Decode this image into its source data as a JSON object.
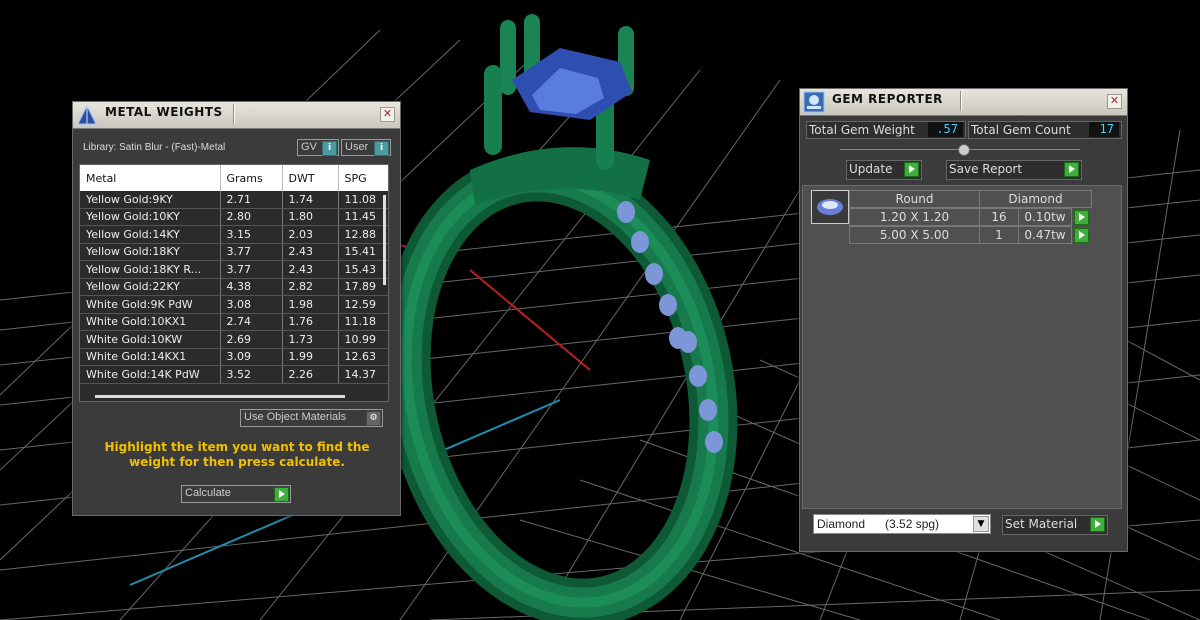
{
  "metal_weights": {
    "title": "METAL WEIGHTS",
    "library": "Library: Satin Blur - (Fast)-Metal",
    "gv_label": "GV",
    "user_label": "User",
    "columns": [
      "Metal",
      "Grams",
      "DWT",
      "SPG"
    ],
    "rows": [
      [
        "Yellow Gold:9KY",
        "2.71",
        "1.74",
        "11.08"
      ],
      [
        "Yellow Gold:10KY",
        "2.80",
        "1.80",
        "11.45"
      ],
      [
        "Yellow Gold:14KY",
        "3.15",
        "2.03",
        "12.88"
      ],
      [
        "Yellow Gold:18KY",
        "3.77",
        "2.43",
        "15.41"
      ],
      [
        "Yellow Gold:18KY R...",
        "3.77",
        "2.43",
        "15.43"
      ],
      [
        "Yellow Gold:22KY",
        "4.38",
        "2.82",
        "17.89"
      ],
      [
        "White Gold:9K PdW",
        "3.08",
        "1.98",
        "12.59"
      ],
      [
        "White Gold:10KX1",
        "2.74",
        "1.76",
        "11.18"
      ],
      [
        "White Gold:10KW",
        "2.69",
        "1.73",
        "10.99"
      ],
      [
        "White Gold:14KX1",
        "3.09",
        "1.99",
        "12.63"
      ],
      [
        "White Gold:14K PdW",
        "3.52",
        "2.26",
        "14.37"
      ]
    ],
    "use_object_materials": "Use Object Materials",
    "instruction": "Highlight the item you want to find the weight for then press calculate.",
    "calculate_label": "Calculate",
    "colors": {
      "instruction": "#f0c000",
      "header_bg": "#ffffff"
    }
  },
  "gem_reporter": {
    "title": "GEM REPORTER",
    "total_weight_label": "Total Gem Weight",
    "total_weight_value": ".57",
    "total_count_label": "Total Gem Count",
    "total_count_value": "17",
    "update_label": "Update",
    "save_report_label": "Save Report",
    "gem_header": {
      "cut": "Round",
      "material": "Diamond"
    },
    "gems": [
      {
        "size": "1.20 X 1.20",
        "count": "16",
        "weight": "0.10tw"
      },
      {
        "size": "5.00 X 5.00",
        "count": "1",
        "weight": "0.47tw"
      }
    ],
    "material_select": "Diamond      (3.52 spg)",
    "set_material_label": "Set Material",
    "colors": {
      "value_text": "#3fd2ff",
      "button_green": "#3fae3a"
    }
  }
}
